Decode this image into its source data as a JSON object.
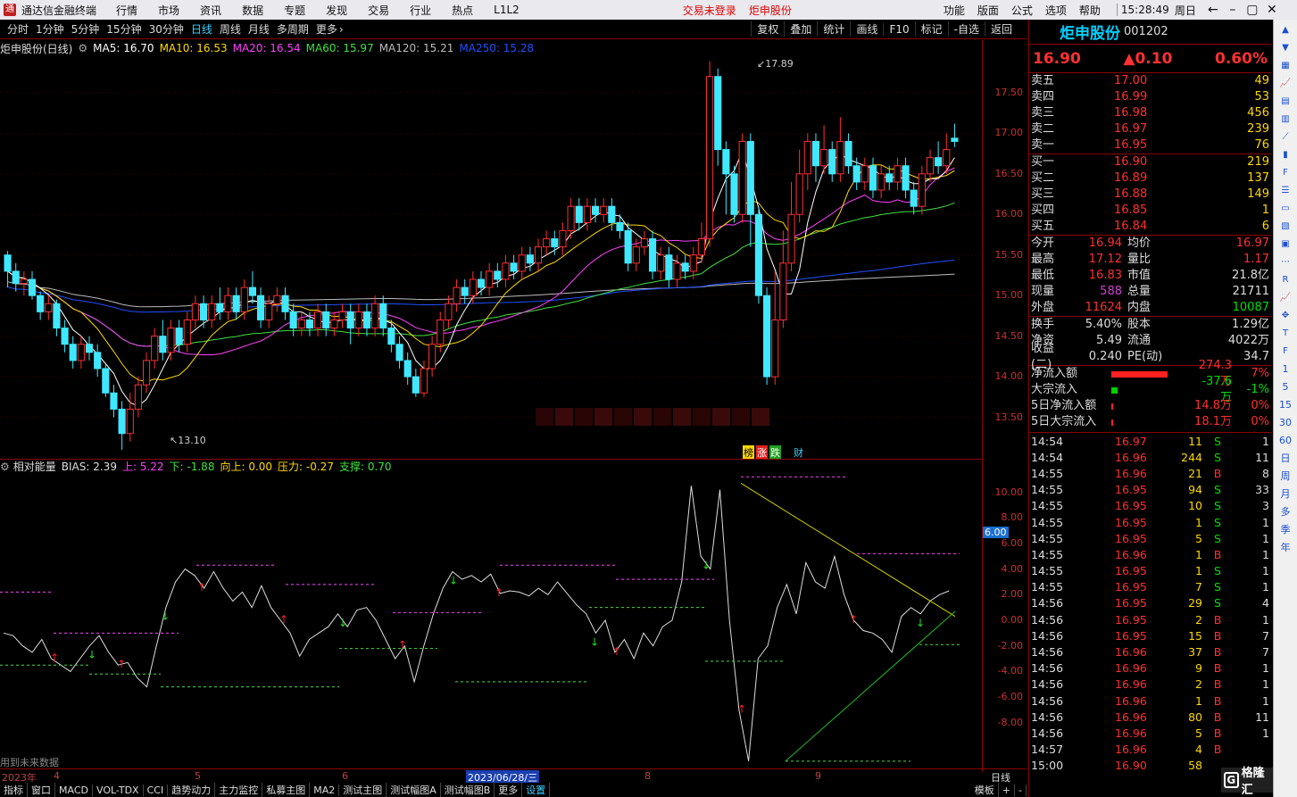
{
  "window": {
    "app_title": "通达信金融终端",
    "menu": [
      "行情",
      "市场",
      "资讯",
      "数据",
      "专题",
      "发现",
      "交易",
      "行业",
      "热点",
      "L1L2"
    ],
    "status_red": [
      "交易未登录",
      "炬申股份"
    ],
    "right_menu": [
      "功能",
      "版面",
      "公式",
      "选项",
      "帮助"
    ],
    "time": "15:28:49",
    "weekday": "周日"
  },
  "periods": [
    "分时",
    "1分钟",
    "5分钟",
    "15分钟",
    "30分钟",
    "日线",
    "周线",
    "月线",
    "多周期",
    "更多"
  ],
  "active_period": "日线",
  "chart_tools": [
    "复权",
    "叠加",
    "统计",
    "画线",
    "F10",
    "标记",
    "-自选",
    "返回"
  ],
  "kline_info": {
    "name": "炬申股份(日线)",
    "ma5": "MA5: 16.70",
    "ma10": "MA10: 16.53",
    "ma20": "MA20: 16.54",
    "ma60": "MA60: 15.97",
    "ma120": "MA120: 15.21",
    "ma250": "MA250: 15.28"
  },
  "chart_data": [
    {
      "type": "candlestick",
      "title": "炬申股份(日线)",
      "y_ticks": [
        "17.50",
        "17.00",
        "16.50",
        "16.00",
        "15.50",
        "15.00",
        "14.50",
        "14.00",
        "13.50"
      ],
      "high_label": "17.89",
      "low_label": "13.10",
      "candles": [
        [
          15.5,
          15.3,
          15.55,
          15.1
        ],
        [
          15.3,
          15.15,
          15.4,
          15.05
        ],
        [
          15.15,
          15.2,
          15.3,
          15.0
        ],
        [
          15.2,
          15.0,
          15.3,
          14.95
        ],
        [
          15.0,
          14.8,
          15.05,
          14.7
        ],
        [
          14.8,
          14.9,
          15.0,
          14.7
        ],
        [
          14.9,
          14.6,
          14.95,
          14.5
        ],
        [
          14.6,
          14.4,
          14.7,
          14.3
        ],
        [
          14.4,
          14.2,
          14.5,
          14.1
        ],
        [
          14.2,
          14.4,
          14.5,
          14.1
        ],
        [
          14.4,
          14.3,
          14.5,
          14.2
        ],
        [
          14.3,
          14.1,
          14.4,
          14.0
        ],
        [
          14.1,
          13.8,
          14.15,
          13.75
        ],
        [
          13.8,
          13.6,
          13.9,
          13.5
        ],
        [
          13.6,
          13.3,
          13.7,
          13.1
        ],
        [
          13.3,
          13.6,
          13.8,
          13.2
        ],
        [
          13.6,
          13.9,
          14.0,
          13.5
        ],
        [
          13.9,
          14.2,
          14.3,
          13.8
        ],
        [
          14.2,
          14.5,
          14.6,
          14.1
        ],
        [
          14.5,
          14.3,
          14.7,
          14.2
        ],
        [
          14.3,
          14.6,
          14.7,
          14.2
        ],
        [
          14.6,
          14.4,
          14.7,
          14.3
        ],
        [
          14.4,
          14.7,
          14.8,
          14.3
        ],
        [
          14.7,
          14.9,
          15.0,
          14.6
        ],
        [
          14.9,
          14.7,
          15.0,
          14.6
        ],
        [
          14.7,
          14.9,
          15.0,
          14.6
        ],
        [
          14.9,
          14.8,
          15.1,
          14.7
        ],
        [
          14.8,
          15.0,
          15.1,
          14.7
        ],
        [
          15.0,
          14.8,
          15.1,
          14.7
        ],
        [
          14.8,
          15.1,
          15.2,
          14.7
        ],
        [
          15.1,
          15.0,
          15.3,
          14.9
        ],
        [
          15.0,
          14.7,
          15.1,
          14.6
        ],
        [
          14.7,
          14.9,
          15.0,
          14.6
        ],
        [
          14.9,
          15.0,
          15.1,
          14.8
        ],
        [
          15.0,
          14.8,
          15.1,
          14.7
        ],
        [
          14.8,
          14.6,
          14.9,
          14.5
        ],
        [
          14.6,
          14.7,
          14.8,
          14.5
        ],
        [
          14.7,
          14.6,
          14.8,
          14.5
        ],
        [
          14.6,
          14.8,
          14.9,
          14.5
        ],
        [
          14.8,
          14.6,
          14.9,
          14.5
        ],
        [
          14.6,
          14.7,
          14.8,
          14.5
        ],
        [
          14.7,
          14.8,
          14.9,
          14.6
        ],
        [
          14.8,
          14.6,
          14.9,
          14.4
        ],
        [
          14.6,
          14.8,
          14.9,
          14.5
        ],
        [
          14.8,
          14.6,
          14.9,
          14.5
        ],
        [
          14.6,
          14.9,
          15.0,
          14.5
        ],
        [
          14.9,
          14.6,
          15.0,
          14.5
        ],
        [
          14.6,
          14.4,
          14.7,
          14.3
        ],
        [
          14.4,
          14.2,
          14.5,
          14.1
        ],
        [
          14.2,
          14.0,
          14.3,
          13.9
        ],
        [
          14.0,
          13.8,
          14.1,
          13.75
        ],
        [
          13.8,
          14.1,
          14.2,
          13.75
        ],
        [
          14.1,
          14.4,
          14.5,
          14.0
        ],
        [
          14.4,
          14.7,
          14.8,
          14.3
        ],
        [
          14.7,
          14.9,
          15.0,
          14.6
        ],
        [
          14.9,
          15.1,
          15.2,
          14.8
        ],
        [
          15.1,
          15.0,
          15.2,
          14.9
        ],
        [
          15.0,
          15.2,
          15.3,
          14.9
        ],
        [
          15.2,
          15.1,
          15.3,
          15.0
        ],
        [
          15.1,
          15.3,
          15.4,
          15.0
        ],
        [
          15.3,
          15.2,
          15.4,
          15.1
        ],
        [
          15.2,
          15.4,
          15.5,
          15.1
        ],
        [
          15.4,
          15.3,
          15.5,
          15.2
        ],
        [
          15.3,
          15.5,
          15.6,
          15.2
        ],
        [
          15.5,
          15.4,
          15.6,
          15.3
        ],
        [
          15.4,
          15.6,
          15.7,
          15.3
        ],
        [
          15.6,
          15.7,
          15.8,
          15.5
        ],
        [
          15.7,
          15.6,
          15.8,
          15.5
        ],
        [
          15.6,
          15.8,
          15.9,
          15.5
        ],
        [
          15.8,
          16.1,
          16.2,
          15.7
        ],
        [
          16.1,
          15.9,
          16.2,
          15.8
        ],
        [
          15.9,
          16.1,
          16.2,
          15.8
        ],
        [
          16.1,
          16.0,
          16.2,
          15.9
        ],
        [
          16.0,
          16.1,
          16.2,
          15.9
        ],
        [
          16.1,
          15.9,
          16.2,
          15.8
        ],
        [
          15.9,
          15.8,
          16.0,
          15.7
        ],
        [
          15.8,
          15.4,
          15.9,
          15.3
        ],
        [
          15.4,
          15.6,
          15.7,
          15.3
        ],
        [
          15.6,
          15.7,
          15.8,
          15.5
        ],
        [
          15.7,
          15.3,
          15.8,
          15.2
        ],
        [
          15.3,
          15.5,
          15.6,
          15.2
        ],
        [
          15.5,
          15.2,
          15.6,
          15.1
        ],
        [
          15.2,
          15.4,
          15.5,
          15.1
        ],
        [
          15.4,
          15.3,
          15.5,
          15.2
        ],
        [
          15.3,
          15.5,
          15.6,
          15.2
        ],
        [
          15.5,
          15.7,
          15.9,
          15.4
        ],
        [
          15.7,
          17.7,
          17.89,
          15.6
        ],
        [
          17.7,
          16.8,
          17.8,
          16.6
        ],
        [
          16.8,
          16.5,
          16.9,
          16.0
        ],
        [
          16.5,
          16.0,
          16.6,
          15.9
        ],
        [
          16.0,
          16.9,
          17.0,
          15.9
        ],
        [
          16.9,
          16.0,
          17.0,
          15.6
        ],
        [
          16.0,
          15.0,
          16.1,
          14.9
        ],
        [
          15.0,
          14.0,
          15.1,
          13.9
        ],
        [
          14.0,
          14.7,
          15.3,
          13.9
        ],
        [
          14.7,
          15.4,
          15.8,
          14.6
        ],
        [
          15.4,
          16.0,
          16.4,
          15.3
        ],
        [
          16.0,
          16.5,
          16.8,
          15.9
        ],
        [
          16.5,
          16.9,
          17.0,
          16.3
        ],
        [
          16.9,
          16.6,
          17.0,
          16.4
        ],
        [
          16.6,
          16.8,
          17.1,
          16.5
        ],
        [
          16.8,
          16.5,
          16.9,
          16.4
        ],
        [
          16.5,
          16.9,
          17.2,
          16.4
        ],
        [
          16.9,
          16.6,
          17.0,
          16.5
        ],
        [
          16.6,
          16.4,
          16.7,
          16.3
        ],
        [
          16.4,
          16.6,
          16.7,
          16.3
        ],
        [
          16.6,
          16.3,
          16.7,
          16.2
        ],
        [
          16.3,
          16.5,
          16.6,
          16.2
        ],
        [
          16.5,
          16.4,
          16.6,
          16.3
        ],
        [
          16.4,
          16.6,
          16.7,
          16.3
        ],
        [
          16.6,
          16.3,
          16.7,
          16.2
        ],
        [
          16.3,
          16.1,
          16.4,
          16.0
        ],
        [
          16.1,
          16.5,
          16.6,
          16.0
        ],
        [
          16.5,
          16.7,
          16.8,
          16.4
        ],
        [
          16.7,
          16.6,
          16.9,
          16.5
        ],
        [
          16.6,
          16.8,
          17.0,
          16.5
        ],
        [
          16.94,
          16.9,
          17.12,
          16.83
        ]
      ]
    },
    {
      "type": "line",
      "title": "相对能量",
      "y_ticks": [
        "10.00",
        "8.00",
        "6.00",
        "4.00",
        "2.00",
        "0.00",
        "-2.00",
        "-4.00",
        "-6.00",
        "-8.00"
      ],
      "marker_value": "6.00",
      "bias": [
        -1,
        -1.2,
        -2,
        -2.5,
        -1.5,
        -3,
        -3.5,
        -4,
        -3,
        -2,
        -1.2,
        -2.5,
        -3.5,
        -3.3,
        -4.5,
        -5.2,
        -2,
        1,
        3,
        4,
        3.5,
        2.5,
        3.8,
        2.5,
        1.5,
        2.2,
        1,
        2.7,
        1,
        0,
        -1,
        -2.8,
        -1.5,
        -1,
        -0.5,
        0.5,
        -0.5,
        0.8,
        1,
        0,
        -1.5,
        -3,
        -2,
        -4.8,
        -2,
        0.5,
        2.5,
        3.8,
        3.2,
        3.5,
        3,
        3.6,
        2.1,
        2.3,
        2.2,
        1.9,
        2.5,
        2,
        3,
        2.1,
        1.2,
        0.5,
        -1,
        0,
        -2.5,
        -1.5,
        -3,
        -1,
        -2,
        -0.5,
        0,
        3,
        10.5,
        5,
        4,
        10.2,
        0,
        -7,
        -11,
        -3,
        -2,
        1,
        2.8,
        0.5,
        4.5,
        3,
        2.5,
        5,
        2,
        0,
        -0.8,
        -1,
        -1.5,
        -2.5,
        0.3,
        1,
        0.5,
        1.5,
        2,
        2.3
      ]
    }
  ],
  "sub_info": {
    "name": "相对能量",
    "bias": "BIAS: 2.39",
    "up": "上: 5.22",
    "down": "下: -1.88",
    "upward": "向上: 0.00",
    "pressure": "压力: -0.27",
    "support": "支撑: 0.70"
  },
  "badges": [
    "榜",
    "涨",
    "跌",
    "财"
  ],
  "warn_text": "用到未来数据",
  "dates": [
    "2023年",
    "4",
    "5",
    "6",
    "2023/06/28/三",
    "8",
    "9",
    "日线"
  ],
  "bottom_tabs": [
    "指标",
    "窗口",
    "MACD",
    "VOL-TDX",
    "CCI",
    "趋势动力",
    "主力监控",
    "私募主图",
    "MA2",
    "测试主图",
    "测试幅图A",
    "测试幅图B",
    "更多",
    "设置"
  ],
  "bottom_right": [
    "模板",
    "+",
    "-"
  ],
  "quote": {
    "name": "炬申股份",
    "code": "001202",
    "price": "16.90",
    "change": "▲0.10",
    "pct": "0.60%",
    "asks": [
      {
        "label": "卖五",
        "price": "17.00",
        "vol": "49"
      },
      {
        "label": "卖四",
        "price": "16.99",
        "vol": "53"
      },
      {
        "label": "卖三",
        "price": "16.98",
        "vol": "456"
      },
      {
        "label": "卖二",
        "price": "16.97",
        "vol": "239"
      },
      {
        "label": "卖一",
        "price": "16.95",
        "vol": "76"
      }
    ],
    "bids": [
      {
        "label": "买一",
        "price": "16.90",
        "vol": "219"
      },
      {
        "label": "买二",
        "price": "16.89",
        "vol": "137"
      },
      {
        "label": "买三",
        "price": "16.88",
        "vol": "149"
      },
      {
        "label": "买四",
        "price": "16.85",
        "vol": "1"
      },
      {
        "label": "买五",
        "price": "16.84",
        "vol": "6"
      }
    ],
    "stats": [
      {
        "k1": "今开",
        "v1": "16.94",
        "k2": "均价",
        "v2": "16.97"
      },
      {
        "k1": "最高",
        "v1": "17.12",
        "k2": "量比",
        "v2": "1.17"
      },
      {
        "k1": "最低",
        "v1": "16.83",
        "k2": "市值",
        "v2": "21.8亿"
      },
      {
        "k1": "现量",
        "v1": "588",
        "k2": "总量",
        "v2": "21711"
      },
      {
        "k1": "外盘",
        "v1": "11624",
        "k2": "内盘",
        "v2": "10087"
      }
    ],
    "stats2": [
      {
        "k1": "换手",
        "v1": "5.40%",
        "k2": "股本",
        "v2": "1.29亿"
      },
      {
        "k1": "净资",
        "v1": "5.49",
        "k2": "流通",
        "v2": "4022万"
      },
      {
        "k1": "收益(二)",
        "v1": "0.240",
        "k2": "PE(动)",
        "v2": "34.7"
      }
    ],
    "flows": [
      {
        "label": "净流入额",
        "val": "274.3万",
        "pct": "7%",
        "bar": 0.7,
        "color": "#ff2020"
      },
      {
        "label": "大宗流入",
        "val": "-37.6万",
        "pct": "-1%",
        "bar": 0.08,
        "color": "#00d000"
      },
      {
        "label": "5日净流入额",
        "val": "14.8万",
        "pct": "0%",
        "bar": 0.02,
        "color": "#ff2020"
      },
      {
        "label": "5日大宗流入",
        "val": "18.1万",
        "pct": "0%",
        "bar": 0.02,
        "color": "#ff2020"
      }
    ],
    "ticks": [
      {
        "t": "14:54",
        "p": "16.97",
        "v": "11",
        "s": "S",
        "n": "1"
      },
      {
        "t": "14:54",
        "p": "16.96",
        "v": "244",
        "s": "S",
        "n": "11"
      },
      {
        "t": "14:55",
        "p": "16.96",
        "v": "21",
        "s": "B",
        "n": "8"
      },
      {
        "t": "14:55",
        "p": "16.95",
        "v": "94",
        "s": "S",
        "n": "33"
      },
      {
        "t": "14:55",
        "p": "16.95",
        "v": "10",
        "s": "S",
        "n": "3"
      },
      {
        "t": "14:55",
        "p": "16.95",
        "v": "1",
        "s": "S",
        "n": "1"
      },
      {
        "t": "14:55",
        "p": "16.95",
        "v": "5",
        "s": "S",
        "n": "1"
      },
      {
        "t": "14:55",
        "p": "16.96",
        "v": "1",
        "s": "B",
        "n": "1"
      },
      {
        "t": "14:55",
        "p": "16.95",
        "v": "1",
        "s": "S",
        "n": "1"
      },
      {
        "t": "14:55",
        "p": "16.95",
        "v": "7",
        "s": "S",
        "n": "1"
      },
      {
        "t": "14:56",
        "p": "16.95",
        "v": "29",
        "s": "S",
        "n": "4"
      },
      {
        "t": "14:56",
        "p": "16.95",
        "v": "2",
        "s": "B",
        "n": "1"
      },
      {
        "t": "14:56",
        "p": "16.95",
        "v": "15",
        "s": "B",
        "n": "7"
      },
      {
        "t": "14:56",
        "p": "16.96",
        "v": "37",
        "s": "B",
        "n": "7"
      },
      {
        "t": "14:56",
        "p": "16.96",
        "v": "9",
        "s": "B",
        "n": "1"
      },
      {
        "t": "14:56",
        "p": "16.96",
        "v": "2",
        "s": "B",
        "n": "1"
      },
      {
        "t": "14:56",
        "p": "16.96",
        "v": "1",
        "s": "B",
        "n": "1"
      },
      {
        "t": "14:56",
        "p": "16.96",
        "v": "80",
        "s": "B",
        "n": "11"
      },
      {
        "t": "14:56",
        "p": "16.96",
        "v": "5",
        "s": "B",
        "n": "1"
      },
      {
        "t": "14:57",
        "p": "16.96",
        "v": "4",
        "s": "B",
        "n": ""
      },
      {
        "t": "15:00",
        "p": "16.90",
        "v": "58",
        "s": "",
        "n": ""
      }
    ]
  },
  "toolbar_icons": [
    "arrow-up-icon",
    "arrow-down-icon",
    "grid-icon",
    "chart-icon",
    "table-icon",
    "kline-icon",
    "line-icon",
    "candle-icon",
    "f10-icon",
    "list-icon",
    "doc-icon",
    "bars-icon",
    "news-icon",
    "dots-icon",
    "rsi-icon",
    "chart-icon",
    "move-icon",
    "text-icon",
    "f5-icon"
  ],
  "toolbar_labels": [
    "1",
    "5",
    "15",
    "30",
    "60",
    "日",
    "周",
    "月",
    "多",
    "季",
    "年"
  ],
  "watermark": "格隆汇"
}
